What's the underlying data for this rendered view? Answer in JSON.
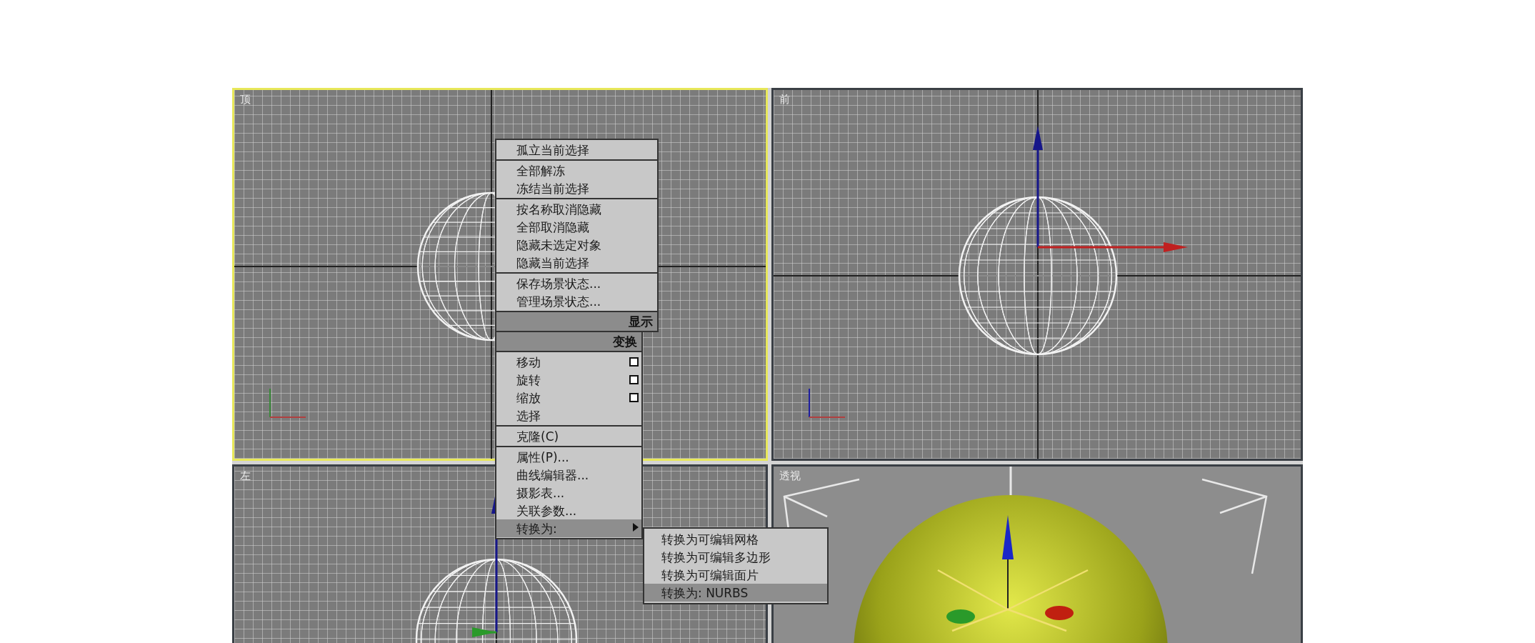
{
  "viewports": [
    {
      "label": "顶",
      "kind": "top",
      "active": true
    },
    {
      "label": "前",
      "kind": "front",
      "active": false
    },
    {
      "label": "左",
      "kind": "left",
      "active": false
    },
    {
      "label": "透视",
      "kind": "perspective",
      "active": false
    }
  ],
  "quad_menu": {
    "quadrants": [
      {
        "title": "显示",
        "groups": [
          [
            {
              "label": "孤立当前选择",
              "kind": "plain",
              "selected": false
            }
          ],
          [
            {
              "label": "全部解冻",
              "kind": "plain",
              "selected": false
            },
            {
              "label": "冻结当前选择",
              "kind": "plain",
              "selected": false
            }
          ],
          [
            {
              "label": "按名称取消隐藏",
              "kind": "plain",
              "selected": false
            },
            {
              "label": "全部取消隐藏",
              "kind": "plain",
              "selected": false
            },
            {
              "label": "隐藏未选定对象",
              "kind": "plain",
              "selected": false
            },
            {
              "label": "隐藏当前选择",
              "kind": "plain",
              "selected": false
            }
          ],
          [
            {
              "label": "保存场景状态...",
              "kind": "plain",
              "selected": false
            },
            {
              "label": "管理场景状态...",
              "kind": "plain",
              "selected": false
            }
          ]
        ]
      },
      {
        "title": "变换",
        "groups": [
          [
            {
              "label": "移动",
              "kind": "options",
              "selected": false
            },
            {
              "label": "旋转",
              "kind": "options",
              "selected": false
            },
            {
              "label": "缩放",
              "kind": "options",
              "selected": false
            },
            {
              "label": "选择",
              "kind": "plain",
              "selected": false
            }
          ],
          [
            {
              "label": "克隆(C)",
              "kind": "plain",
              "selected": false
            }
          ],
          [
            {
              "label": "属性(P)...",
              "kind": "plain",
              "selected": false
            },
            {
              "label": "曲线编辑器...",
              "kind": "plain",
              "selected": false
            },
            {
              "label": "摄影表...",
              "kind": "plain",
              "selected": false
            },
            {
              "label": "关联参数...",
              "kind": "plain",
              "selected": false
            },
            {
              "label": "转换为:",
              "kind": "submenu",
              "selected": true
            }
          ]
        ]
      }
    ],
    "submenu": {
      "items": [
        {
          "label": "转换为可编辑网格",
          "selected": false
        },
        {
          "label": "转换为可编辑多边形",
          "selected": false
        },
        {
          "label": "转换为可编辑面片",
          "selected": false
        },
        {
          "label": "转换为: NURBS",
          "selected": true
        }
      ]
    }
  }
}
